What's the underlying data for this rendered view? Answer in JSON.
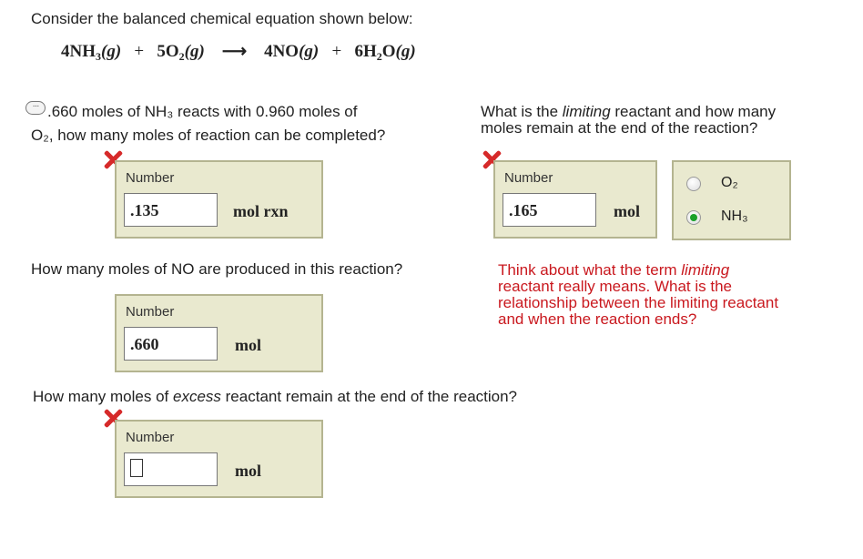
{
  "intro": "Consider the balanced chemical equation shown below:",
  "equation": {
    "t1_coef": "4NH",
    "t1_sub": "3",
    "t1_state": "(g)",
    "plus1": "+",
    "t2_coef": "5O",
    "t2_sub": "2",
    "t2_state": "(g)",
    "arrow": "⟶",
    "p1_coef": "4NO",
    "p1_state": "(g)",
    "plus2": "+",
    "p2_coef": "6H",
    "p2_sub": "2",
    "p2_mid": "O",
    "p2_state": "(g)"
  },
  "q1": {
    "icon": "comment-icon",
    "line1": ".660 moles of NH₃ reacts with 0.960 moles of",
    "line2": "O₂, how many moles of reaction can be completed?",
    "label": "Number",
    "value": ".135",
    "unit": "mol  rxn"
  },
  "q2": {
    "line1": "What is the limiting reactant and how many",
    "line1_pre": "What is the ",
    "line1_em": "limiting",
    "line1_post": " reactant and how many",
    "line2": "moles remain at the end of the reaction?",
    "label": "Number",
    "value": ".165",
    "unit": "mol",
    "options": [
      "O₂",
      "NH₃"
    ],
    "selected": "NH₃",
    "hint": [
      "Think about what the term limiting",
      "reactant really means.  What is the",
      "relationship between the limiting reactant",
      "and when the reaction ends?"
    ],
    "hint_line1_pre": "Think about what the term ",
    "hint_line1_em": "limiting"
  },
  "q3": {
    "question": "How many moles of NO are produced in this reaction?",
    "label": "Number",
    "value": ".660",
    "unit": "mol"
  },
  "q4": {
    "question_pre": "How many moles of ",
    "question_em": "excess",
    "question_post": " reactant remain at the end of the reaction?",
    "label": "Number",
    "value": "",
    "unit": "mol"
  },
  "colors": {
    "incorrect_mark": "#d62a2a",
    "hint_text": "#c9181e",
    "answer_box_bg": "#e9e9cf",
    "answer_box_border": "#b4b490",
    "radio_selected": "#1aa12a"
  }
}
